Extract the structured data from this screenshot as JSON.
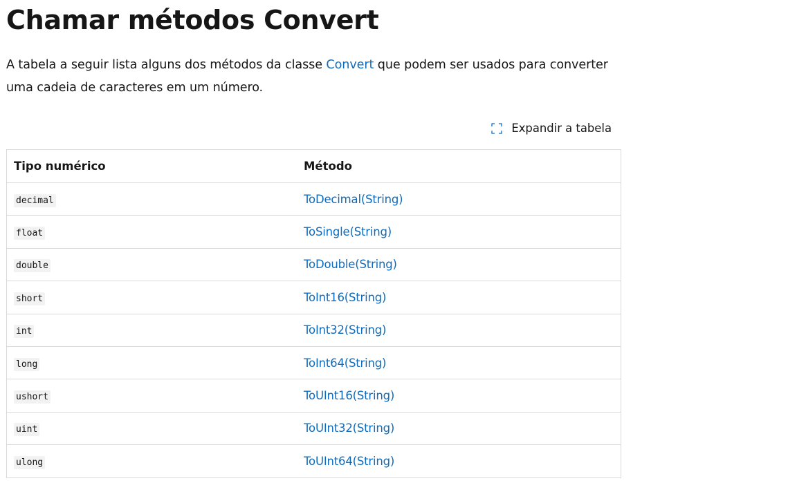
{
  "heading": "Chamar métodos Convert",
  "intro": {
    "before": "A tabela a seguir lista alguns dos métodos da classe ",
    "link": "Convert",
    "after": " que podem ser usados para converter uma cadeia de caracteres em um número."
  },
  "expand": {
    "label": "Expandir a tabela",
    "icon": "expand-icon"
  },
  "table": {
    "headers": [
      "Tipo numérico",
      "Método"
    ],
    "rows": [
      {
        "type": "decimal",
        "method": "ToDecimal(String)"
      },
      {
        "type": "float",
        "method": "ToSingle(String)"
      },
      {
        "type": "double",
        "method": "ToDouble(String)"
      },
      {
        "type": "short",
        "method": "ToInt16(String)"
      },
      {
        "type": "int",
        "method": "ToInt32(String)"
      },
      {
        "type": "long",
        "method": "ToInt64(String)"
      },
      {
        "type": "ushort",
        "method": "ToUInt16(String)"
      },
      {
        "type": "uint",
        "method": "ToUInt32(String)"
      },
      {
        "type": "ulong",
        "method": "ToUInt64(String)"
      }
    ]
  },
  "colors": {
    "link": "#0f6cbd",
    "text": "#161616",
    "border": "#d9d9d9",
    "code_bg": "#f2f2f2"
  }
}
